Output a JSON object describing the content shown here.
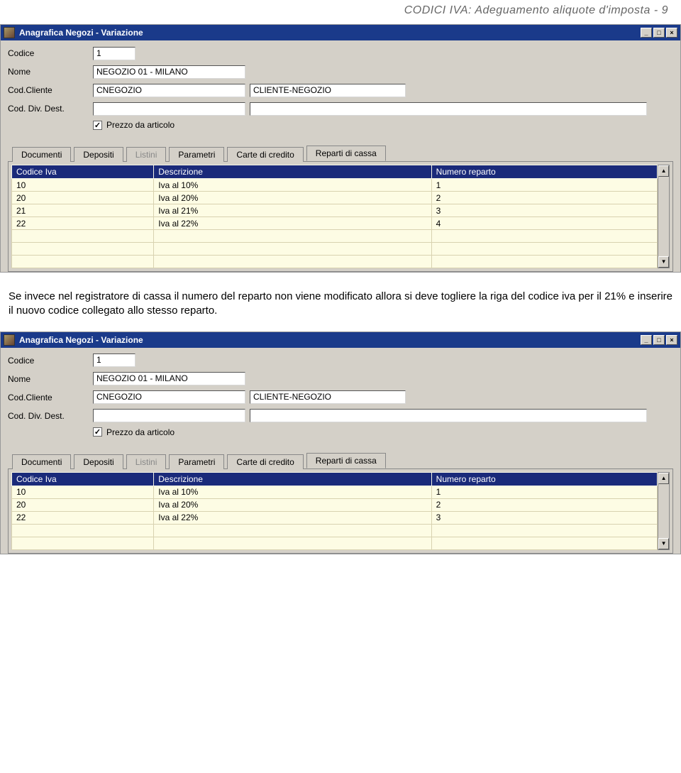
{
  "page_header": "CODICI IVA: Adeguamento aliquote d'imposta -   9",
  "paragraph": "Se invece nel registratore di cassa il numero del reparto non viene modificato allora si deve togliere la riga del codice iva per il 21% e inserire il nuovo codice collegato allo stesso reparto.",
  "window": {
    "title": "Anagrafica Negozi - Variazione",
    "btn_min": "_",
    "btn_max": "□",
    "btn_close": "×",
    "fields": {
      "codice_label": "Codice",
      "codice_value": "1",
      "nome_label": "Nome",
      "nome_value": "NEGOZIO 01 - MILANO",
      "codcliente_label": "Cod.Cliente",
      "codcliente_value": "CNEGOZIO",
      "codcliente_desc": "CLIENTE-NEGOZIO",
      "coddivdest_label": "Cod. Div. Dest.",
      "coddivdest_value": "",
      "coddivdest_desc": "",
      "chk_label": "Prezzo da articolo",
      "chk_checked": "✓"
    },
    "tabs": {
      "documenti": "Documenti",
      "depositi": "Depositi",
      "listini": "Listini",
      "parametri": "Parametri",
      "carte": "Carte di credito",
      "reparti": "Reparti di cassa"
    },
    "grid_headers": {
      "col1": "Codice Iva",
      "col2": "Descrizione",
      "col3": "Numero reparto"
    }
  },
  "chart_data": [
    {
      "type": "table",
      "title": "Reparti di cassa (before)",
      "columns": [
        "Codice Iva",
        "Descrizione",
        "Numero reparto"
      ],
      "rows": [
        [
          "10",
          "Iva al 10%",
          "1"
        ],
        [
          "20",
          "Iva al 20%",
          "2"
        ],
        [
          "21",
          "Iva al 21%",
          "3"
        ],
        [
          "22",
          "Iva al 22%",
          "4"
        ]
      ]
    },
    {
      "type": "table",
      "title": "Reparti di cassa (after)",
      "columns": [
        "Codice Iva",
        "Descrizione",
        "Numero reparto"
      ],
      "rows": [
        [
          "10",
          "Iva al 10%",
          "1"
        ],
        [
          "20",
          "Iva al 20%",
          "2"
        ],
        [
          "22",
          "Iva al 22%",
          "3"
        ]
      ]
    }
  ]
}
